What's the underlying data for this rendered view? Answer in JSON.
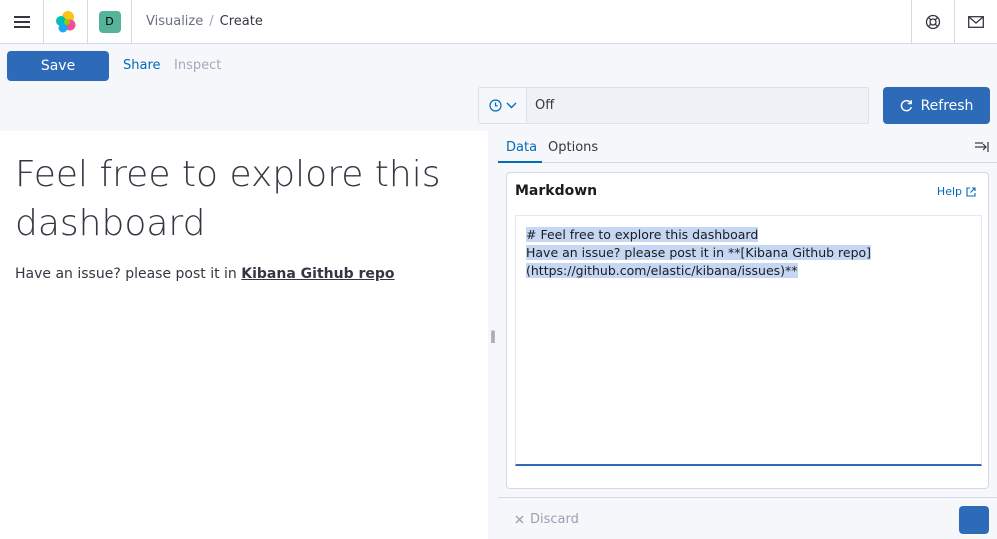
{
  "header": {
    "space_initial": "D",
    "breadcrumbs": [
      "Visualize",
      "Create"
    ]
  },
  "topnav": {
    "save_label": "Save",
    "share_label": "Share",
    "inspect_label": "Inspect",
    "refresh_interval_value": "Off",
    "refresh_label": "Refresh"
  },
  "preview": {
    "heading": "Feel free to explore this dashboard",
    "paragraph_prefix": "Have an issue? please post it in ",
    "link_text": "Kibana Github repo"
  },
  "editor": {
    "tabs": [
      "Data",
      "Options"
    ],
    "panel_title": "Markdown",
    "help_label": "Help",
    "markdown_lines": [
      "# Feel free to explore this dashboard",
      "Have an issue? please post it in **[Kibana Github repo]",
      "(https://github.com/elastic/kibana/issues)**"
    ],
    "discard_label": "Discard"
  },
  "colors": {
    "primary": "#2d6bb9",
    "link": "#006bb8",
    "avatar": "#54b399"
  }
}
